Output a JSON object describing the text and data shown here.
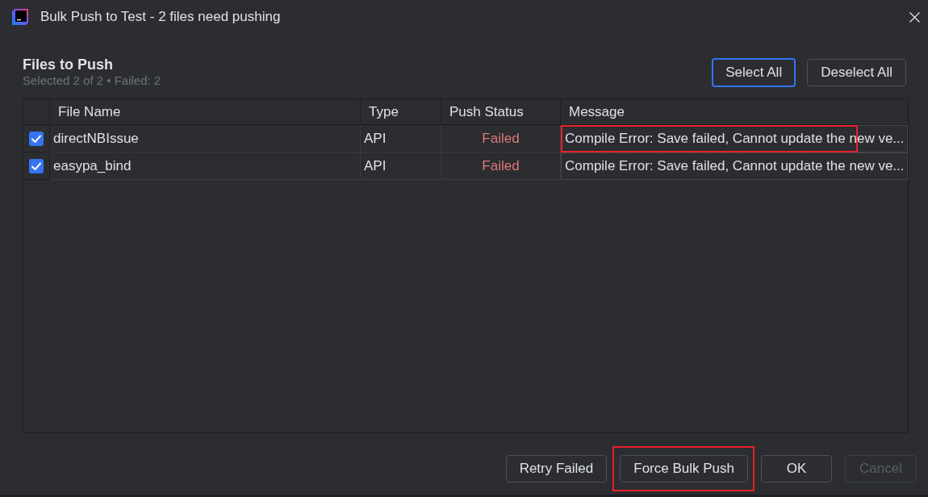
{
  "window": {
    "title": "Bulk Push to Test - 2 files need pushing"
  },
  "header": {
    "title": "Files to Push",
    "summary": "Selected 2 of 2 • Failed: 2"
  },
  "selection_buttons": [
    {
      "label": "Select All",
      "focused": true
    },
    {
      "label": "Deselect All",
      "focused": false
    }
  ],
  "table": {
    "columns": [
      "File Name",
      "Type",
      "Push Status",
      "Message"
    ],
    "rows": [
      {
        "checked": true,
        "file_name": "directNBIssue",
        "type": "API",
        "push_status": "Failed",
        "failed": true,
        "message": "Compile Error: Save failed, Cannot update the new ve...",
        "highlighted": true
      },
      {
        "checked": true,
        "file_name": "easypa_bind",
        "type": "API",
        "push_status": "Failed",
        "failed": true,
        "message": "Compile Error: Save failed, Cannot update the new ve...",
        "highlighted": false
      }
    ]
  },
  "buttons": [
    {
      "label": "Retry Failed",
      "disabled": false,
      "highlighted": false
    },
    {
      "label": "Force Bulk Push",
      "disabled": false,
      "highlighted": true
    },
    {
      "label": "OK",
      "disabled": false,
      "highlighted": false
    },
    {
      "label": "Cancel",
      "disabled": true,
      "highlighted": false
    }
  ]
}
